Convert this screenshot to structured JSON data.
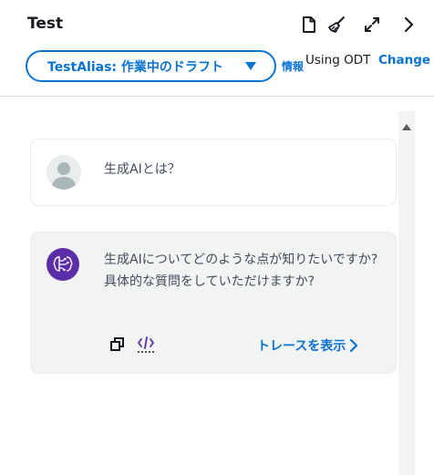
{
  "header": {
    "title": "Test",
    "icons": [
      "document-icon",
      "broom-icon",
      "expand-icon",
      "chevron-right-icon"
    ]
  },
  "alias": {
    "label": "TestAlias: 作業中のドラフト",
    "info": "情報",
    "odt_text": "Using ODT",
    "odt_change": "Change"
  },
  "messages": {
    "user": "生成AIとは？",
    "bot": "生成AIについてどのような点が知りたいですか? 具体的な質問をしていただけますか?",
    "trace_label": "トレースを表示"
  },
  "colors": {
    "accent": "#0972d3",
    "bot_avatar": "#5a2ea6",
    "bot_bubble": "#f2f3f3"
  }
}
